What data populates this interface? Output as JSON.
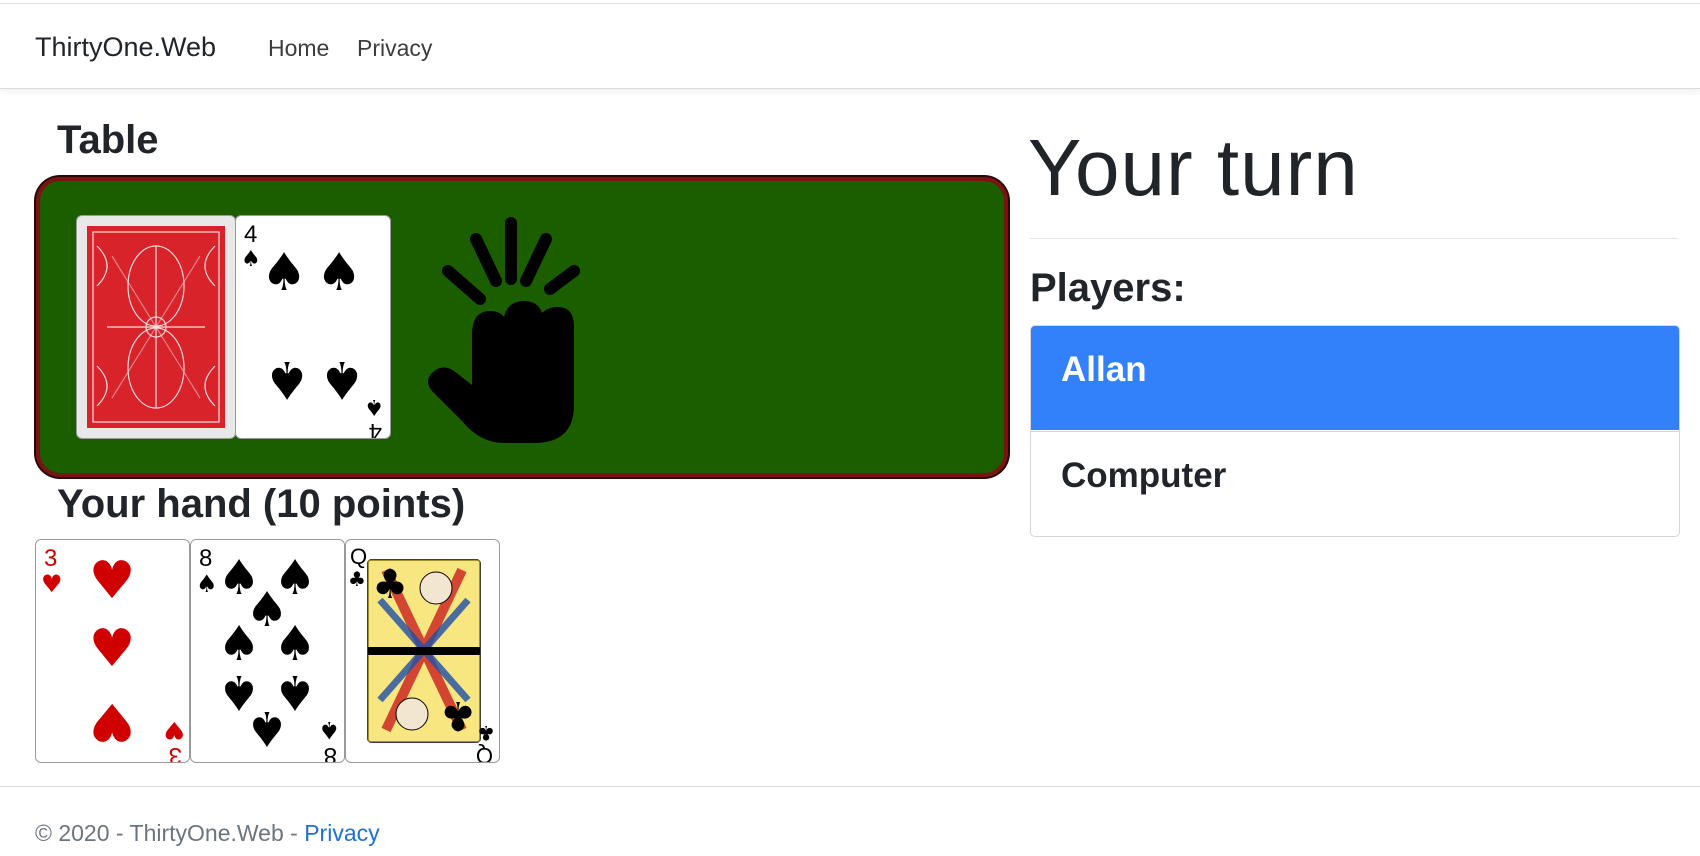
{
  "nav": {
    "brand": "ThirtyOne.Web",
    "links": [
      "Home",
      "Privacy"
    ]
  },
  "table": {
    "heading": "Table",
    "deck_back_color": "#d8232a",
    "felt_color": "#1b5e00",
    "discard_card": {
      "rank": "4",
      "suit": "spades",
      "symbol": "♠"
    },
    "knock_icon": "knock-hand-icon"
  },
  "hand": {
    "heading": "Your hand (10 points)",
    "cards": [
      {
        "rank": "3",
        "suit": "hearts",
        "symbol": "♥"
      },
      {
        "rank": "8",
        "suit": "spades",
        "symbol": "♠"
      },
      {
        "rank": "Q",
        "suit": "clubs",
        "symbol": "♣"
      }
    ]
  },
  "status": {
    "turn_text": "Your turn"
  },
  "players": {
    "heading": "Players:",
    "list": [
      "Allan",
      "Computer"
    ],
    "active": "Allan",
    "active_color": "#3381fa"
  },
  "footer": {
    "text": "© 2020 - ThirtyOne.Web - ",
    "link": "Privacy"
  }
}
